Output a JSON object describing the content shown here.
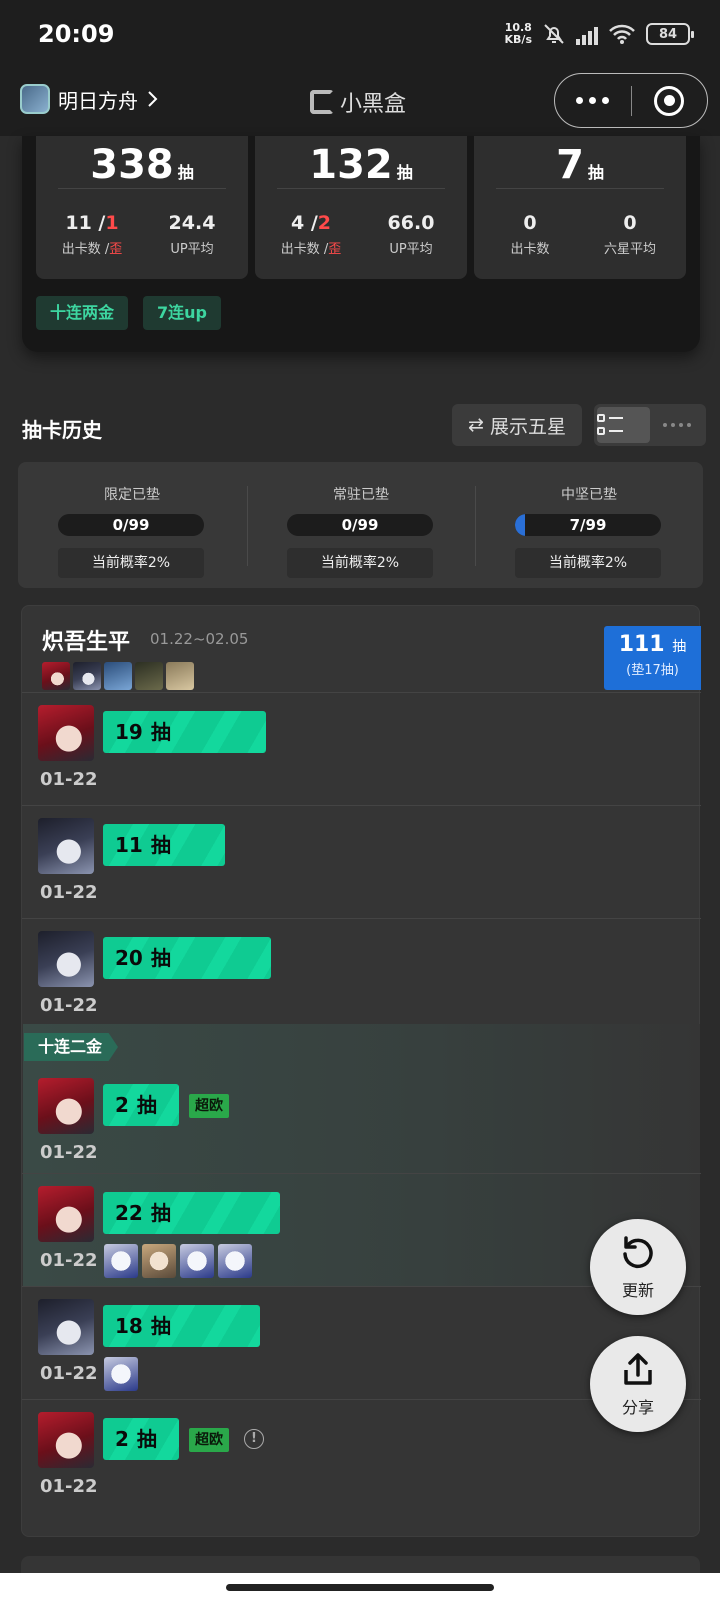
{
  "status_bar": {
    "time": "20:09",
    "net_speed_value": "10.8",
    "net_speed_unit": "KB/s",
    "battery": "84"
  },
  "nav": {
    "game_name": "明日方舟",
    "app_title": "小黑盒"
  },
  "stats": [
    {
      "total": "338",
      "unit": "抽",
      "c1_main": "11 /",
      "c1_red": "1",
      "c1_label_main": "出卡数 /",
      "c1_label_red": "歪",
      "c2_value": "24.4",
      "c2_label": "UP平均"
    },
    {
      "total": "132",
      "unit": "抽",
      "c1_main": "4 /",
      "c1_red": "2",
      "c1_label_main": "出卡数 /",
      "c1_label_red": "歪",
      "c2_value": "66.0",
      "c2_label": "UP平均"
    },
    {
      "total": "7",
      "unit": "抽",
      "c1_main": "0",
      "c1_red": "",
      "c1_label_main": "出卡数",
      "c1_label_red": "",
      "c2_value": "0",
      "c2_label": "六星平均"
    }
  ],
  "tags": [
    "十连两金",
    "7连up"
  ],
  "history": {
    "title": "抽卡历史",
    "show_five_label": "展示五星",
    "swap_glyph": "⇄"
  },
  "pity": [
    {
      "label": "限定已垫",
      "count": "0/99",
      "fill_fraction": 0.0,
      "rate": "当前概率2%"
    },
    {
      "label": "常驻已垫",
      "count": "0/99",
      "fill_fraction": 0.0,
      "rate": "当前概率2%"
    },
    {
      "label": "中坚已垫",
      "count": "7/99",
      "fill_fraction": 0.07,
      "rate": "当前概率2%"
    }
  ],
  "banner": {
    "name": "炽吾生平",
    "date_range": "01.22~02.05",
    "total": "111",
    "total_unit": "抽",
    "pity_note": "(垫17抽)",
    "group_tag": "十连二金",
    "pull_unit": "抽",
    "lucky_badge": "超欧",
    "info_glyph": "!",
    "rows": [
      {
        "pulls": "19",
        "date": "01-22"
      },
      {
        "pulls": "11",
        "date": "01-22"
      },
      {
        "pulls": "20",
        "date": "01-22"
      },
      {
        "pulls": "2",
        "date": "01-22"
      },
      {
        "pulls": "22",
        "date": "01-22"
      },
      {
        "pulls": "18",
        "date": "01-22"
      },
      {
        "pulls": "2",
        "date": "01-22"
      }
    ]
  },
  "fab": {
    "refresh_label": "更新",
    "share_label": "分享"
  }
}
